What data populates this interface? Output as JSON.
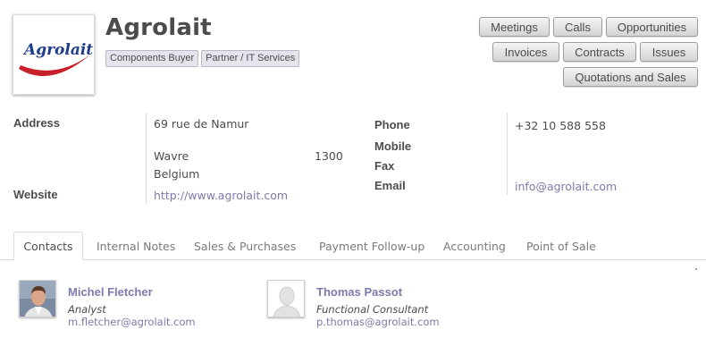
{
  "partner": {
    "name": "Agrolait",
    "logo_text": "Agrolait",
    "tags": [
      "Components Buyer",
      "Partner / IT Services"
    ]
  },
  "buttons": {
    "meetings": "Meetings",
    "calls": "Calls",
    "opportunities": "Opportunities",
    "invoices": "Invoices",
    "contracts": "Contracts",
    "issues": "Issues",
    "quotations": "Quotations and Sales"
  },
  "address": {
    "label": "Address",
    "street": "69 rue de Namur",
    "city": "Wavre",
    "zip": "1300",
    "country": "Belgium"
  },
  "website": {
    "label": "Website",
    "value": "http://www.agrolait.com"
  },
  "phone": {
    "label": "Phone",
    "value": "+32 10 588 558"
  },
  "mobile": {
    "label": "Mobile",
    "value": ""
  },
  "fax": {
    "label": "Fax",
    "value": ""
  },
  "email": {
    "label": "Email",
    "value": "info@agrolait.com"
  },
  "tabs": [
    "Contacts",
    "Internal Notes",
    "Sales & Purchases",
    "Payment Follow-up",
    "Accounting",
    "Point of Sale"
  ],
  "contacts": [
    {
      "name": "Michel Fletcher",
      "function": "Analyst",
      "email": "m.fletcher@agrolait.com",
      "avatar_icon": "person-photo-icon"
    },
    {
      "name": "Thomas Passot",
      "function": "Functional Consultant",
      "email": "p.thomas@agrolait.com",
      "avatar_icon": "person-placeholder-icon"
    }
  ],
  "colors": {
    "link": "#7c7bad",
    "logo_blue": "#1f3c8c",
    "logo_red": "#c8202a"
  }
}
